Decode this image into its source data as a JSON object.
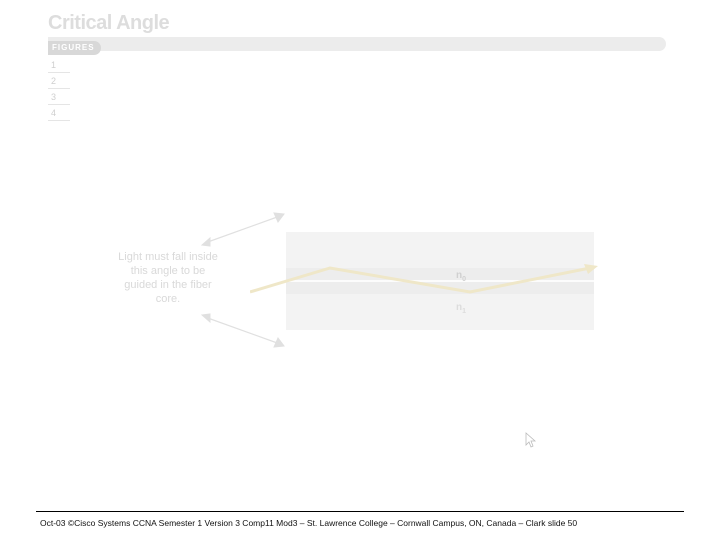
{
  "title": "Critical Angle",
  "header_label": "FIGURES",
  "figure_tabs": [
    "1",
    "2",
    "3",
    "4"
  ],
  "diagram": {
    "caption": "Light must fall inside this angle to be guided in the fiber core.",
    "index_outer": "n",
    "index_outer_sub": "0",
    "index_inner": "n",
    "index_inner_sub": "1"
  },
  "footer": "Oct-03 ©Cisco Systems CCNA Semester 1 Version 3 Comp11 Mod3 – St. Lawrence College – Cornwall Campus, ON, Canada – Clark slide 50"
}
